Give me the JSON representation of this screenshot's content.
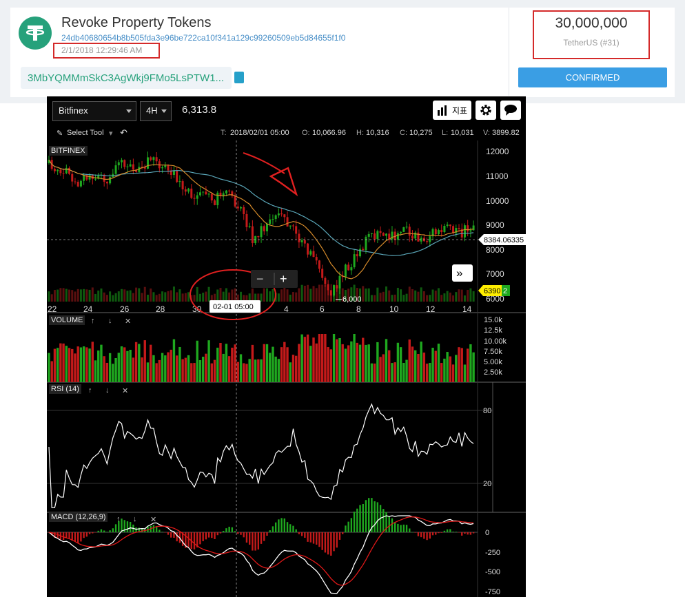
{
  "transaction": {
    "title": "Revoke Property Tokens",
    "hash": "24db40680654b8b505fda3e96be722ca10f341a129c99260509eb5d84655f1f0",
    "datetime": "2/1/2018 12:29:46 AM",
    "address": "3MbYQMMmSkC3AgWkj9FMo5LsPTW1...",
    "amount": "30,000,000",
    "token": "TetherUS (#31)",
    "status": "CONFIRMED",
    "logo_color": "#26a17b",
    "status_color": "#3a9ee4",
    "highlight_color": "#d42a2a"
  },
  "chart_widget": {
    "exchange": "Bitfinex",
    "interval": "4H",
    "last_price": "6,313.8",
    "indicators_label": "지표",
    "select_tool": "Select Tool",
    "ohlc": {
      "t_label": "T:",
      "t": "2018/02/01 05:00",
      "o_label": "O:",
      "o": "10,066.96",
      "h_label": "H:",
      "h": "10,316",
      "c_label": "C:",
      "c": "10,275",
      "l_label": "L:",
      "l": "10,031",
      "v_label": "V:",
      "v": "3899.82"
    },
    "main_label": "BITFINEX",
    "crosshair_price": "8384.06335",
    "current_price_tag": "6390",
    "current_price_suffix": "2",
    "low_marker": "6,000",
    "crosshair_time": "02-01 05:00",
    "zoom_out": "−",
    "zoom_in": "+",
    "scroll_right": "»",
    "volume_label": "VOLUME",
    "rsi_label": "RSI (14)",
    "macd_label": "MACD (12,26,9)"
  },
  "chart_data": {
    "type": "candlestick",
    "x_ticks": [
      "22",
      "24",
      "26",
      "28",
      "30",
      "2",
      "4",
      "6",
      "8",
      "10",
      "12",
      "14"
    ],
    "price_axis": [
      "12000",
      "11000",
      "10000",
      "9000",
      "8000",
      "7000",
      "6000"
    ],
    "price_ylim": [
      6000,
      12000
    ],
    "volume_axis": [
      "15.0k",
      "12.5k",
      "10.00k",
      "7.50k",
      "5.00k",
      "2.50k"
    ],
    "rsi_axis": [
      "80",
      "20"
    ],
    "macd_axis": [
      "0",
      "-250",
      "-500",
      "-750"
    ],
    "colors": {
      "up": "#1fa81f",
      "down": "#c41a1a",
      "ma_fast": "#d58a2a",
      "ma_slow": "#5aa6b8",
      "rsi": "#ffffff",
      "macd": "#ffffff",
      "signal": "#e01818"
    }
  }
}
